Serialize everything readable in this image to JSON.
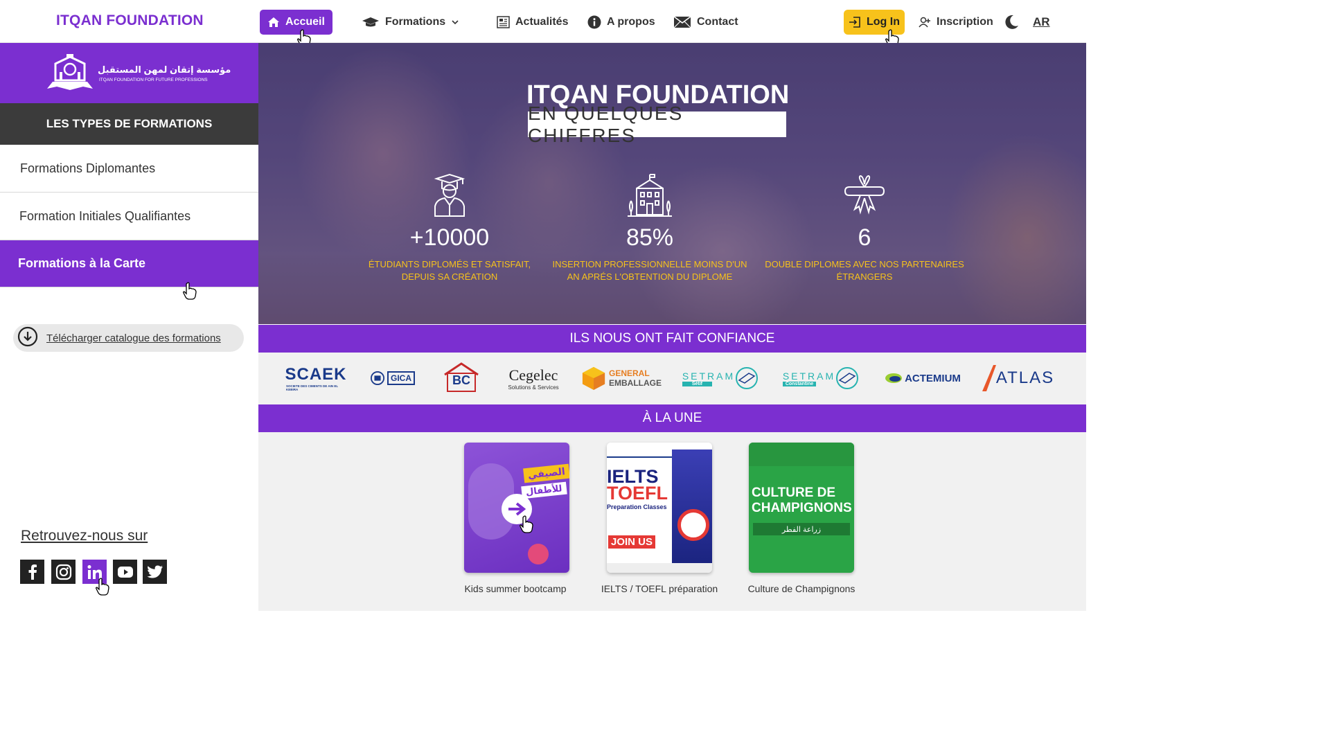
{
  "brand": "ITQAN FOUNDATION",
  "nav": {
    "accueil": "Accueil",
    "formations": "Formations",
    "actualites": "Actualités",
    "apropos": "A propos",
    "contact": "Contact",
    "login": "Log In",
    "inscription": "Inscription",
    "lang": "AR"
  },
  "sidebar": {
    "logo_ar": "مؤسسة إتقان لمهن المستقبل",
    "logo_en": "ITQAN FOUNDATION FOR FUTURE PROFESSIONS",
    "heading": "LES TYPES DE FORMATIONS",
    "items": [
      {
        "label": "Formations Diplomantes"
      },
      {
        "label": "Formation Initiales Qualifiantes"
      },
      {
        "label": "Formations à la Carte"
      }
    ],
    "catalog": "Télécharger catalogue des formations",
    "follow": "Retrouvez-nous sur"
  },
  "hero": {
    "title": "ITQAN FOUNDATION",
    "subtitle": "EN QUELQUES CHIFFRES",
    "stats": [
      {
        "value": "+10000",
        "caption_l1": "ÉTUDIANTS DIPLOMÉS ET SATISFAIT,",
        "caption_l2": "DEPUIS SA CRÉATION",
        "icon": "graduate-icon"
      },
      {
        "value": "85%",
        "caption_l1": "INSERTION PROFESSIONNELLE MOINS D'UN",
        "caption_l2": "AN APRÉS L'OBTENTION DU DIPLOME",
        "icon": "school-building-icon"
      },
      {
        "value": "6",
        "caption_l1": "DOUBLE DIPLOMES AVEC NOS PARTENAIRES",
        "caption_l2": "ÉTRANGERS",
        "icon": "diploma-ribbon-icon"
      }
    ]
  },
  "partners": {
    "heading": "ILS NOUS ONT FAIT CONFIANCE",
    "logos": [
      {
        "name": "SCAEK",
        "sub": "SOCIETE DES CIMENTS DE AIN EL KEBIRA"
      },
      {
        "name": "GICA"
      },
      {
        "name": "BC"
      },
      {
        "name": "Cegelec",
        "sub": "Solutions & Services"
      },
      {
        "name": "GENERAL",
        "name2": "EMBALLAGE"
      },
      {
        "name": "SETRAM",
        "sub": "Sétif"
      },
      {
        "name": "SETRAM",
        "sub": "Constantine"
      },
      {
        "name": "ACTEMIUM"
      },
      {
        "name": "ATLAS"
      }
    ]
  },
  "une": {
    "heading": "À LA UNE",
    "cards": [
      {
        "caption": "Kids summer bootcamp",
        "text1": "للأطفال",
        "text2": "الصيفي"
      },
      {
        "caption": "IELTS / TOEFL préparation",
        "text1": "IELTS",
        "text2": "TOEFL",
        "text3": "Preparation Classes",
        "text4": "JOIN US"
      },
      {
        "caption": "Culture de Champignons",
        "text1": "CULTURE DE",
        "text2": "CHAMPIGNONS",
        "text3": "زراعة الفطر"
      }
    ]
  },
  "colors": {
    "purple": "#7b2fd0",
    "yellow": "#f7c21b",
    "dark": "#3b3b3b",
    "gold_text": "#f7c21b"
  }
}
